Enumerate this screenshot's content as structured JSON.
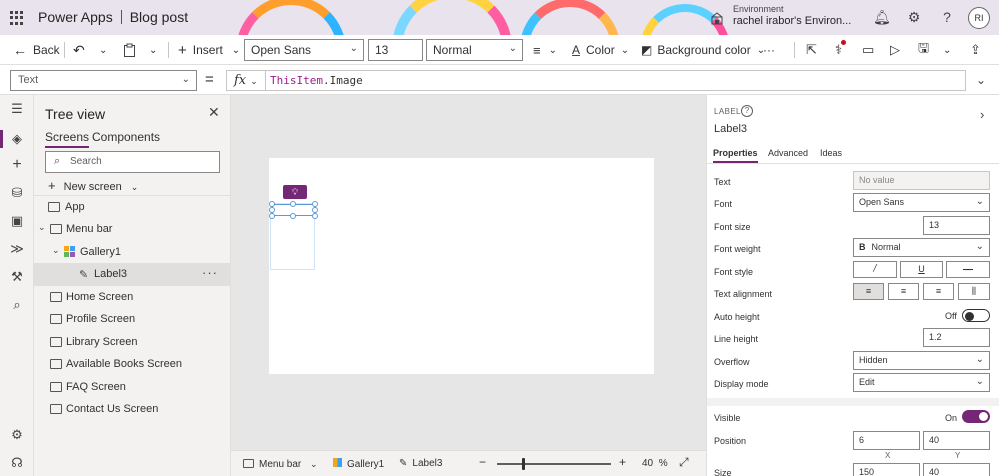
{
  "titlebar": {
    "app_name": "Power Apps",
    "document_name": "Blog post",
    "environment_label": "Environment",
    "environment_name": "rachel irabor's Environ...",
    "avatar_initials": "RI"
  },
  "commandbar": {
    "back_label": "Back",
    "insert_label": "Insert",
    "font_family": "Open Sans",
    "font_size": "13",
    "font_weight": "Normal",
    "color_label": "Color",
    "background_color_label": "Background color",
    "more_label": "···"
  },
  "formulabar": {
    "property": "Text",
    "equals": "=",
    "fx_label": "fx",
    "formula_keyword": "ThisItem",
    "formula_rest": ".Image"
  },
  "treeview": {
    "title": "Tree view",
    "tabs": [
      "Screens",
      "Components"
    ],
    "search_placeholder": "Search",
    "new_screen_label": "New screen",
    "items": {
      "app": "App",
      "menu_bar": "Menu bar",
      "gallery1": "Gallery1",
      "label3": "Label3",
      "home_screen": "Home Screen",
      "profile_screen": "Profile Screen",
      "library_screen": "Library Screen",
      "available_books_screen": "Available Books Screen",
      "faq_screen": "FAQ Screen",
      "contact_us_screen": "Contact Us Screen"
    }
  },
  "statusbar": {
    "screen_crumb": "Menu bar",
    "gallery_crumb": "Gallery1",
    "label_crumb": "Label3",
    "zoom_value": "40",
    "zoom_unit": "%",
    "zoom_fraction": 0.22
  },
  "properties": {
    "control_type": "LABEL",
    "control_name": "Label3",
    "tabs": [
      "Properties",
      "Advanced",
      "Ideas"
    ],
    "rows": {
      "text_label": "Text",
      "text_value": "No value",
      "font_label": "Font",
      "font_value": "Open Sans",
      "font_size_label": "Font size",
      "font_size_value": "13",
      "font_weight_label": "Font weight",
      "font_weight_value": "Normal",
      "font_style_label": "Font style",
      "text_alignment_label": "Text alignment",
      "auto_height_label": "Auto height",
      "auto_height_state": "Off",
      "line_height_label": "Line height",
      "line_height_value": "1.2",
      "overflow_label": "Overflow",
      "overflow_value": "Hidden",
      "display_mode_label": "Display mode",
      "display_mode_value": "Edit",
      "visible_label": "Visible",
      "visible_state": "On",
      "position_label": "Position",
      "position_x": "6",
      "position_y": "40",
      "x_axis": "X",
      "y_axis": "Y",
      "size_label": "Size",
      "size_width": "150",
      "size_height": "40"
    }
  },
  "colors": {
    "accent": "#742774",
    "selection": "#5b9bd5"
  }
}
